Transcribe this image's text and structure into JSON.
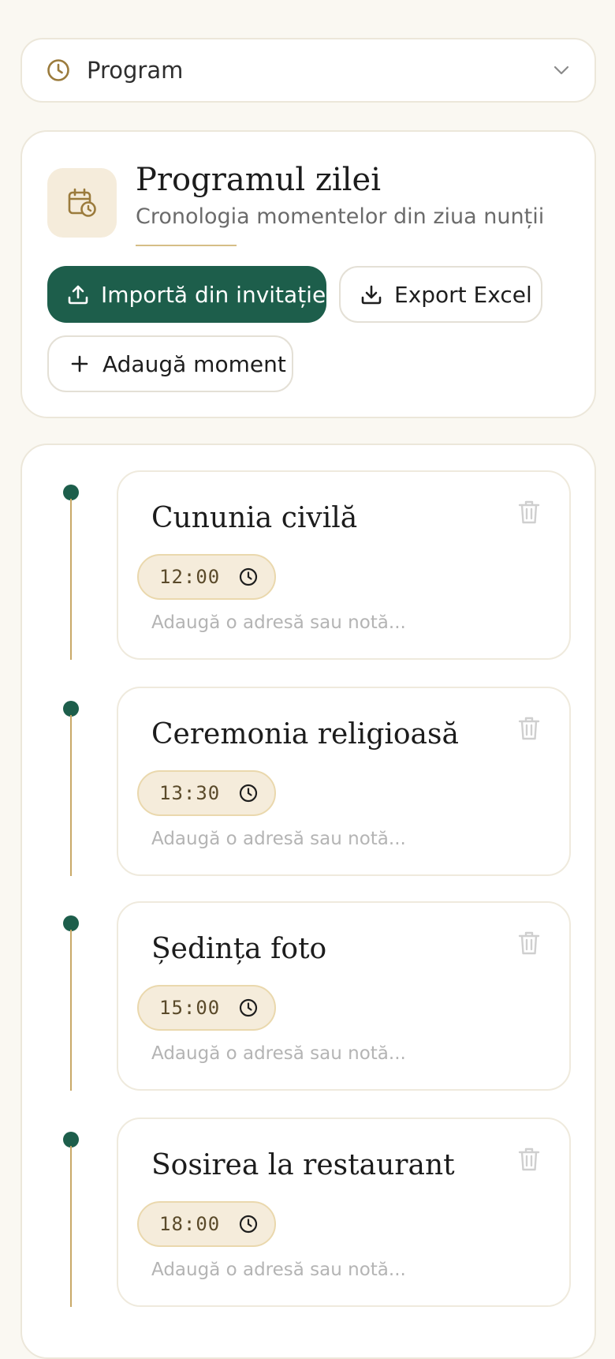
{
  "selector": {
    "label": "Program",
    "icon": "clock-icon",
    "chevron": "chevron-down-icon"
  },
  "header": {
    "title": "Programul zilei",
    "subtitle": "Cronologia momentelor din ziua nunții",
    "icon": "calendar-clock-icon"
  },
  "actions": {
    "import_label": "Importă din invitație",
    "export_label": "Export Excel",
    "add_label": "Adaugă moment"
  },
  "colors": {
    "primary": "#1d5e4b",
    "accent": "#c9a968",
    "pill_bg": "#f5ecdb",
    "background": "#faf8f2"
  },
  "events": [
    {
      "title": "Cununia civilă",
      "time": "12:00",
      "note_placeholder": "Adaugă o adresă sau notă..."
    },
    {
      "title": "Ceremonia religioasă",
      "time": "13:30",
      "note_placeholder": "Adaugă o adresă sau notă..."
    },
    {
      "title": "Ședința foto",
      "time": "15:00",
      "note_placeholder": "Adaugă o adresă sau notă..."
    },
    {
      "title": "Sosirea la restaurant",
      "time": "18:00",
      "note_placeholder": "Adaugă o adresă sau notă..."
    }
  ]
}
